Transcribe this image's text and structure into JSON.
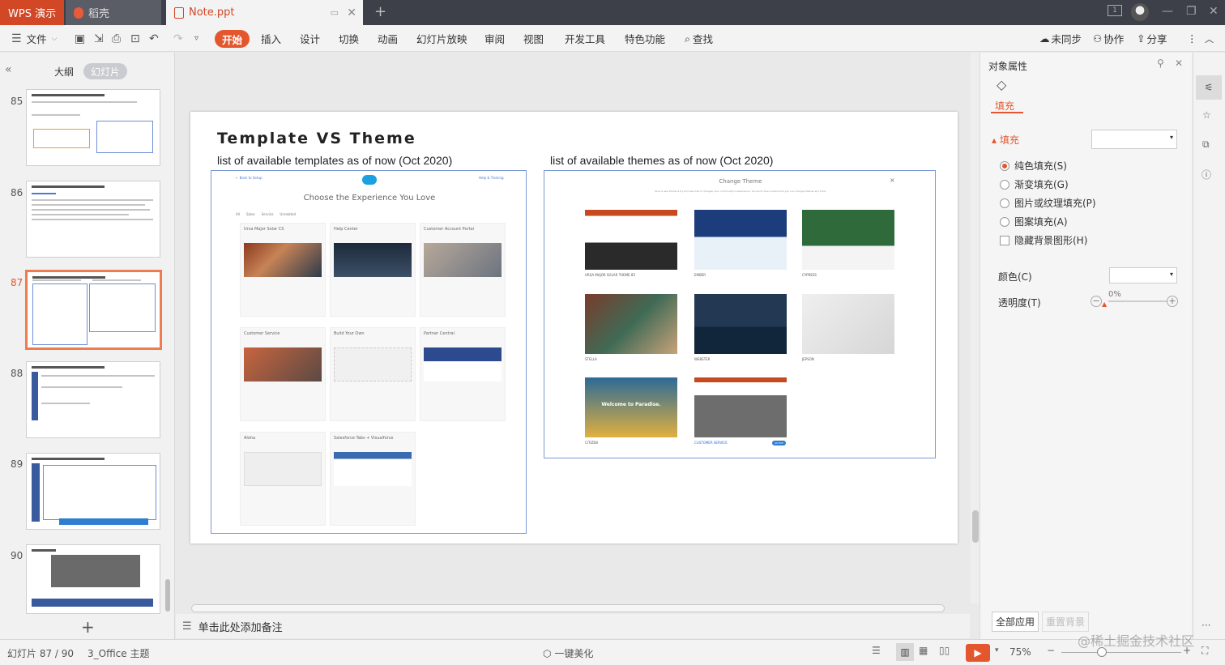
{
  "titlebar": {
    "app_tab": "WPS 演示",
    "daoke_tab": "稻壳",
    "doc_tab": "Note.ppt",
    "add_tab": "+"
  },
  "ribbon": {
    "file": "文件",
    "tabs": [
      "开始",
      "插入",
      "设计",
      "切换",
      "动画",
      "幻灯片放映",
      "审阅",
      "视图",
      "开发工具",
      "特色功能"
    ],
    "find": "查找",
    "sync": "未同步",
    "collab": "协作",
    "share": "分享"
  },
  "left_panel": {
    "outline_tab": "大纲",
    "slides_tab": "幻灯片",
    "thumbnails": [
      {
        "num": "85"
      },
      {
        "num": "86"
      },
      {
        "num": "87"
      },
      {
        "num": "88"
      },
      {
        "num": "89"
      },
      {
        "num": "90"
      }
    ],
    "add": "+"
  },
  "slide": {
    "title": "Template VS Theme",
    "left_caption": "list of available templates as of now (Oct 2020)",
    "right_caption": "list of available themes as of now (Oct 2020)",
    "left_shot": {
      "back": "← Back to Setup",
      "help": "Help & Training",
      "heading": "Choose the Experience You Love",
      "filters": [
        "All",
        "Sales",
        "Service",
        "Unrelated"
      ],
      "cards": [
        "Ursa Major Solar CS",
        "Help Center",
        "Customer Account Portal",
        "Customer Service",
        "Build Your Own",
        "Partner Central",
        "Aloha",
        "Salesforce Tabs + Visualforce"
      ]
    },
    "right_shot": {
      "heading": "Change Theme",
      "close": "×",
      "subtitle": "Give a new theme a try and see how it changes your community's experience. You won't lose content and you can change themes any time.",
      "themes": [
        "URSA MAJOR SOLAR THEME 85",
        "EMBER",
        "CYPRESS",
        "STELLA",
        "WEBSTER",
        "JEPSON",
        "CITIZEN",
        "CUSTOMER SERVICE"
      ],
      "banner_citizen": "Welcome to Paradise.",
      "active_badge": "ACTIVE"
    }
  },
  "notes": {
    "placeholder": "单击此处添加备注"
  },
  "right_panel": {
    "title": "对象属性",
    "fill_tab": "填充",
    "fill_section": "填充",
    "options": [
      "纯色填充(S)",
      "渐变填充(G)",
      "图片或纹理填充(P)",
      "图案填充(A)"
    ],
    "hide_bg": "隐藏背景图形(H)",
    "color_label": "颜色(C)",
    "transparency_label": "透明度(T)",
    "transparency_value": "0%",
    "apply_all": "全部应用",
    "reset_bg": "重置背景"
  },
  "status": {
    "slide_info": "幻灯片 87 / 90",
    "theme": "3_Office 主题",
    "beautify": "一键美化",
    "zoom": "75%",
    "watermark": "@稀土掘金技术社区"
  },
  "colors": {
    "accent": "#e4572e",
    "titlebar": "#3d4049",
    "selection": "#f07c4e",
    "link_blue": "#7d99d4"
  }
}
